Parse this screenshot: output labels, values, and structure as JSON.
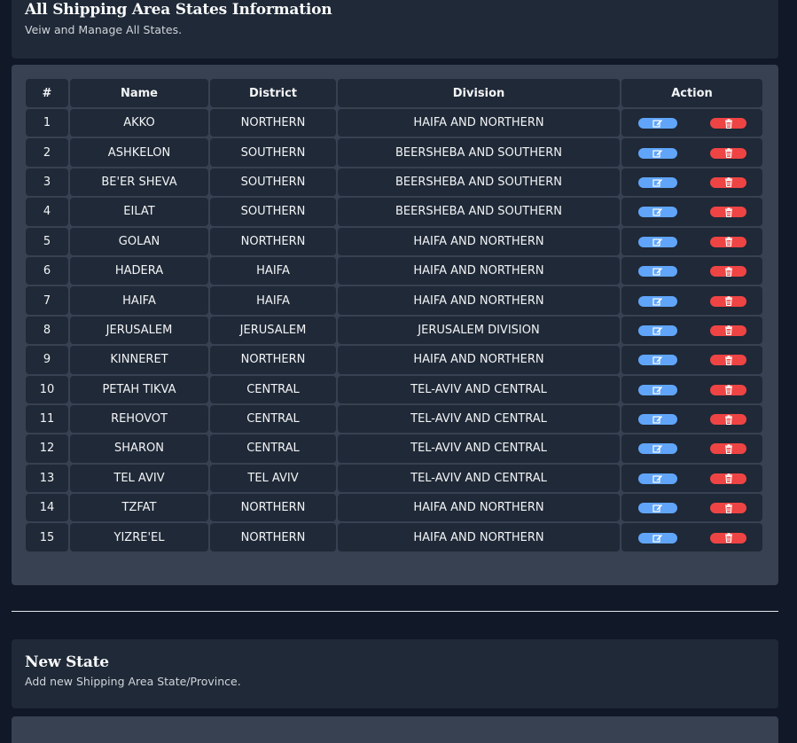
{
  "header": {
    "title": "All Shipping Area States Information",
    "subtitle": "Veiw and Manage All States."
  },
  "table": {
    "headers": [
      "#",
      "Name",
      "District",
      "Division",
      "Action"
    ],
    "rows": [
      {
        "num": "1",
        "name": "AKKO",
        "district": "NORTHERN",
        "division": "HAIFA AND NORTHERN"
      },
      {
        "num": "2",
        "name": "ASHKELON",
        "district": "SOUTHERN",
        "division": "BEERSHEBA AND SOUTHERN"
      },
      {
        "num": "3",
        "name": "BE'ER SHEVA",
        "district": "SOUTHERN",
        "division": "BEERSHEBA AND SOUTHERN"
      },
      {
        "num": "4",
        "name": "EILAT",
        "district": "SOUTHERN",
        "division": "BEERSHEBA AND SOUTHERN"
      },
      {
        "num": "5",
        "name": "GOLAN",
        "district": "NORTHERN",
        "division": "HAIFA AND NORTHERN"
      },
      {
        "num": "6",
        "name": "HADERA",
        "district": "HAIFA",
        "division": "HAIFA AND NORTHERN"
      },
      {
        "num": "7",
        "name": "HAIFA",
        "district": "HAIFA",
        "division": "HAIFA AND NORTHERN"
      },
      {
        "num": "8",
        "name": "JERUSALEM",
        "district": "JERUSALEM",
        "division": "JERUSALEM DIVISION"
      },
      {
        "num": "9",
        "name": "KINNERET",
        "district": "NORTHERN",
        "division": "HAIFA AND NORTHERN"
      },
      {
        "num": "10",
        "name": "PETAH TIKVA",
        "district": "CENTRAL",
        "division": "TEL-AVIV AND CENTRAL"
      },
      {
        "num": "11",
        "name": "REHOVOT",
        "district": "CENTRAL",
        "division": "TEL-AVIV AND CENTRAL"
      },
      {
        "num": "12",
        "name": "SHARON",
        "district": "CENTRAL",
        "division": "TEL-AVIV AND CENTRAL"
      },
      {
        "num": "13",
        "name": "TEL AVIV",
        "district": "TEL AVIV",
        "division": "TEL-AVIV AND CENTRAL"
      },
      {
        "num": "14",
        "name": "TZFAT",
        "district": "NORTHERN",
        "division": "HAIFA AND NORTHERN"
      },
      {
        "num": "15",
        "name": "YIZRE'EL",
        "district": "NORTHERN",
        "division": "HAIFA AND NORTHERN"
      }
    ],
    "actions": {
      "edit_icon": "edit-icon",
      "delete_icon": "trash-icon"
    }
  },
  "new_state": {
    "title": "New State",
    "subtitle": "Add new Shipping Area State/Province."
  },
  "colors": {
    "background": "#111827",
    "card": "#1f2937",
    "panel": "#374151",
    "edit_button": "#60a5fa",
    "delete_button": "#ef4444"
  }
}
